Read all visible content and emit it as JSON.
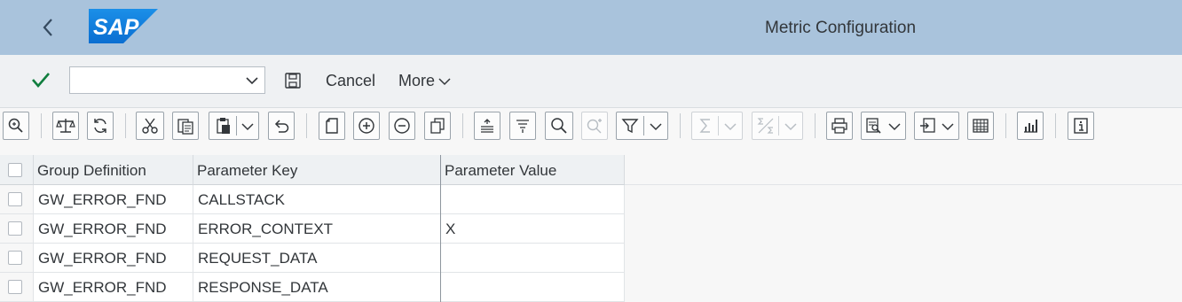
{
  "header": {
    "logo_text": "SAP",
    "title": "Metric Configuration"
  },
  "actions": {
    "command_value": "",
    "cancel_label": "Cancel",
    "more_label": "More"
  },
  "toolbar": {
    "buttons": [
      "zoom-icon",
      "balance-icon",
      "refresh-icon",
      "cut-icon",
      "copy-icon",
      "paste-icon",
      "undo-icon",
      "new-icon",
      "insert-row-icon",
      "delete-row-icon",
      "duplicate-row-icon",
      "sort-ascending-icon",
      "sort-descending-icon",
      "find-icon",
      "find-next-icon",
      "filter-icon",
      "sum-icon",
      "subtotal-icon",
      "print-icon",
      "print-preview-icon",
      "export-icon",
      "layout-icon",
      "chart-icon",
      "info-icon"
    ]
  },
  "table": {
    "columns": [
      "Group Definition",
      "Parameter Key",
      "Parameter Value"
    ],
    "rows": [
      [
        "GW_ERROR_FND",
        "CALLSTACK",
        ""
      ],
      [
        "GW_ERROR_FND",
        "ERROR_CONTEXT",
        "X"
      ],
      [
        "GW_ERROR_FND",
        "REQUEST_DATA",
        ""
      ],
      [
        "GW_ERROR_FND",
        "RESPONSE_DATA",
        ""
      ]
    ]
  },
  "colors": {
    "shell": "#a9c3dc",
    "brand": "#0a6ed1",
    "accept": "#107e3e",
    "text": "#32363a"
  }
}
